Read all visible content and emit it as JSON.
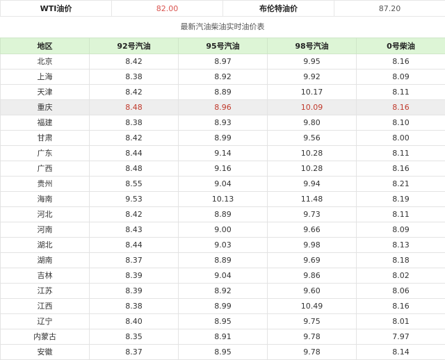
{
  "oil_prices": {
    "wti_label": "WTI油价",
    "wti_value": "82.00",
    "brent_label": "布伦特油价",
    "brent_value": "87.20"
  },
  "table_title": "最新汽油柴油实时油价表",
  "columns": [
    "地区",
    "92号汽油",
    "95号汽油",
    "98号汽油",
    "0号柴油"
  ],
  "rows": [
    {
      "region": "北京",
      "p92": "8.42",
      "p95": "8.97",
      "p98": "9.95",
      "p0": "8.16"
    },
    {
      "region": "上海",
      "p92": "8.38",
      "p95": "8.92",
      "p98": "9.92",
      "p0": "8.09"
    },
    {
      "region": "天津",
      "p92": "8.42",
      "p95": "8.89",
      "p98": "10.17",
      "p0": "8.11"
    },
    {
      "region": "重庆",
      "p92": "8.48",
      "p95": "8.96",
      "p98": "10.09",
      "p0": "8.16"
    },
    {
      "region": "福建",
      "p92": "8.38",
      "p95": "8.93",
      "p98": "9.80",
      "p0": "8.10"
    },
    {
      "region": "甘肃",
      "p92": "8.42",
      "p95": "8.99",
      "p98": "9.56",
      "p0": "8.00"
    },
    {
      "region": "广东",
      "p92": "8.44",
      "p95": "9.14",
      "p98": "10.28",
      "p0": "8.11"
    },
    {
      "region": "广西",
      "p92": "8.48",
      "p95": "9.16",
      "p98": "10.28",
      "p0": "8.16"
    },
    {
      "region": "贵州",
      "p92": "8.55",
      "p95": "9.04",
      "p98": "9.94",
      "p0": "8.21"
    },
    {
      "region": "海南",
      "p92": "9.53",
      "p95": "10.13",
      "p98": "11.48",
      "p0": "8.19"
    },
    {
      "region": "河北",
      "p92": "8.42",
      "p95": "8.89",
      "p98": "9.73",
      "p0": "8.11"
    },
    {
      "region": "河南",
      "p92": "8.43",
      "p95": "9.00",
      "p98": "9.66",
      "p0": "8.09"
    },
    {
      "region": "湖北",
      "p92": "8.44",
      "p95": "9.03",
      "p98": "9.98",
      "p0": "8.13"
    },
    {
      "region": "湖南",
      "p92": "8.37",
      "p95": "8.89",
      "p98": "9.69",
      "p0": "8.18"
    },
    {
      "region": "吉林",
      "p92": "8.39",
      "p95": "9.04",
      "p98": "9.86",
      "p0": "8.02"
    },
    {
      "region": "江苏",
      "p92": "8.39",
      "p95": "8.92",
      "p98": "9.60",
      "p0": "8.06"
    },
    {
      "region": "江西",
      "p92": "8.38",
      "p95": "8.99",
      "p98": "10.49",
      "p0": "8.16"
    },
    {
      "region": "辽宁",
      "p92": "8.40",
      "p95": "8.95",
      "p98": "9.75",
      "p0": "8.01"
    },
    {
      "region": "内蒙古",
      "p92": "8.35",
      "p95": "8.91",
      "p98": "9.78",
      "p0": "7.97"
    },
    {
      "region": "安徽",
      "p92": "8.37",
      "p95": "8.95",
      "p98": "9.78",
      "p0": "8.14"
    }
  ],
  "highlighted_row_index": 3
}
